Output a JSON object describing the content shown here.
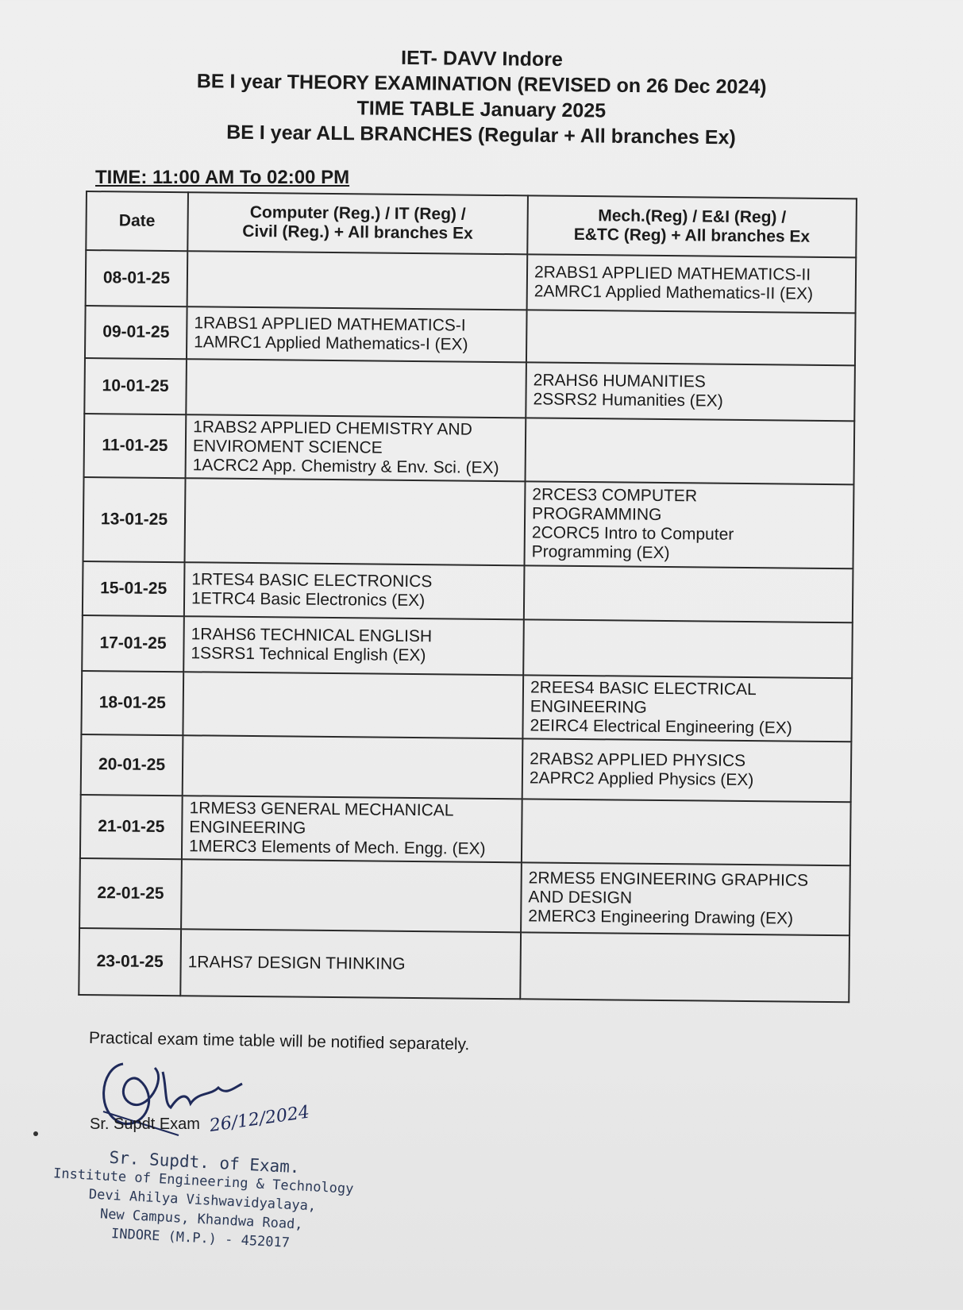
{
  "header": {
    "line1": "IET- DAVV Indore",
    "line2": "BE I year THEORY EXAMINATION (REVISED on 26 Dec 2024)",
    "line3": "TIME TABLE January 2025",
    "line4": "BE I year ALL BRANCHES (Regular + All branches Ex)"
  },
  "time": "TIME: 11:00 AM To 02:00 PM",
  "table": {
    "col_date": "Date",
    "col1_l1": "Computer (Reg.)  / IT (Reg) /",
    "col1_l2": "Civil (Reg.) + All branches Ex",
    "col2_l1": "Mech.(Reg) / E&I (Reg) /",
    "col2_l2": "E&TC (Reg) + All branches Ex",
    "rows": [
      {
        "date": "08-01-25",
        "c1": [
          "",
          ""
        ],
        "c2": [
          "2RABS1 APPLIED MATHEMATICS-II",
          "2AMRC1 Applied Mathematics-II (EX)"
        ]
      },
      {
        "date": "09-01-25",
        "c1": [
          "1RABS1 APPLIED MATHEMATICS-I",
          "1AMRC1 Applied Mathematics-I (EX)"
        ],
        "c2": [
          "",
          ""
        ]
      },
      {
        "date": "10-01-25",
        "c1": [
          "",
          ""
        ],
        "c2": [
          "2RAHS6 HUMANITIES",
          "2SSRS2 Humanities (EX)"
        ]
      },
      {
        "date": "11-01-25",
        "c1": [
          "1RABS2 APPLIED CHEMISTRY AND",
          "ENVIROMENT SCIENCE",
          "1ACRC2 App. Chemistry & Env. Sci. (EX)"
        ],
        "c2": [
          "",
          ""
        ]
      },
      {
        "date": "13-01-25",
        "c1": [
          "",
          ""
        ],
        "c2": [
          "2RCES3 COMPUTER",
          "PROGRAMMING",
          "2CORC5 Intro to Computer",
          "Programming (EX)"
        ]
      },
      {
        "date": "15-01-25",
        "c1": [
          "1RTES4 BASIC ELECTRONICS",
          "1ETRC4 Basic Electronics (EX)"
        ],
        "c2": [
          "",
          ""
        ]
      },
      {
        "date": "17-01-25",
        "c1": [
          "1RAHS6 TECHNICAL ENGLISH",
          "1SSRS1 Technical English (EX)"
        ],
        "c2": [
          "",
          ""
        ]
      },
      {
        "date": "18-01-25",
        "c1": [
          "",
          ""
        ],
        "c2": [
          "2REES4 BASIC ELECTRICAL",
          "ENGINEERING",
          "2EIRC4 Electrical Engineering (EX)"
        ]
      },
      {
        "date": "20-01-25",
        "c1": [
          "",
          ""
        ],
        "c2": [
          "2RABS2 APPLIED PHYSICS",
          "2APRC2 Applied Physics (EX)"
        ]
      },
      {
        "date": "21-01-25",
        "c1": [
          "1RMES3 GENERAL MECHANICAL",
          "ENGINEERING",
          "1MERC3 Elements of Mech. Engg. (EX)"
        ],
        "c2": [
          "",
          ""
        ]
      },
      {
        "date": "22-01-25",
        "c1": [
          "",
          ""
        ],
        "c2": [
          "2RMES5 ENGINEERING GRAPHICS",
          "AND DESIGN",
          "2MERC3 Engineering Drawing (EX)"
        ]
      },
      {
        "date": "23-01-25",
        "c1": [
          "1RAHS7 DESIGN THINKING",
          ""
        ],
        "c2": [
          "",
          ""
        ]
      }
    ]
  },
  "note": "Practical exam time table will be notified separately.",
  "signature": {
    "caption": "Sr. Supdt Exam",
    "date_handwritten": "26/12/2024"
  },
  "stamp": {
    "line1": "Sr. Supdt. of  Exam.",
    "line2": "Institute of Engineering & Technology",
    "line3": "Devi Ahilya Vishwavidyalaya,",
    "line4": "New Campus, Khandwa Road,",
    "line5": "INDORE (M.P.) - 452017"
  }
}
